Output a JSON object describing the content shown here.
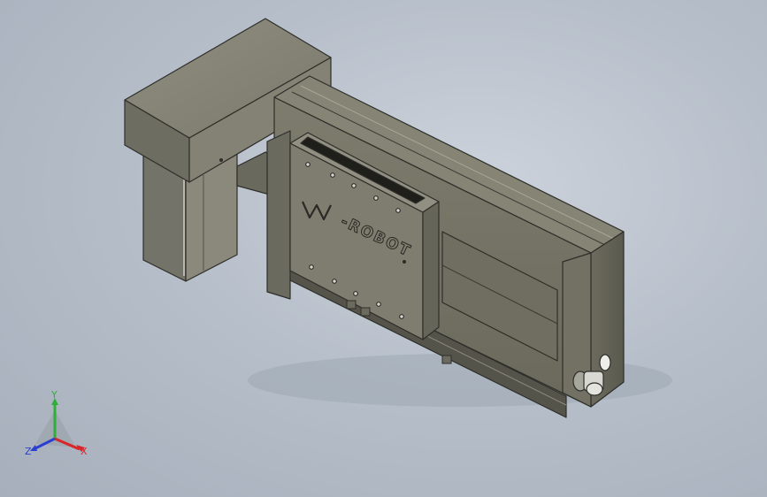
{
  "viewport": {
    "logo_text": "-ROBOT",
    "colors": {
      "background_center": "#cdd3dc",
      "background_edge": "#a6afbb",
      "body_light": "#8b8a7b",
      "body_mid": "#777666",
      "body_dark": "#5f5e52",
      "edge": "#2e2e2a"
    }
  },
  "triad": {
    "x_label": "X",
    "y_label": "Y",
    "z_label": "Z",
    "x_color": "#d8262a",
    "y_color": "#2fae3a",
    "z_color": "#2a3fd0"
  }
}
